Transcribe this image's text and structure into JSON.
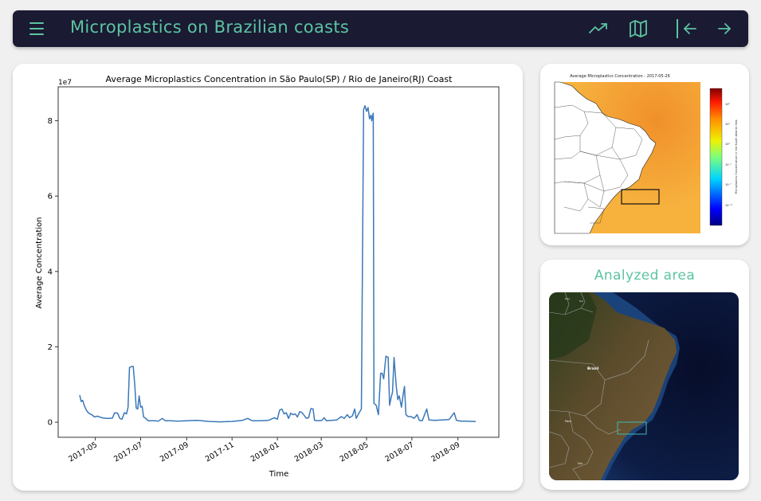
{
  "header": {
    "title": "Microplastics on Brazilian coasts",
    "icons": [
      "menu-icon",
      "trending-up-icon",
      "map-icon",
      "arrow-left-icon",
      "arrow-right-icon"
    ]
  },
  "colors": {
    "navbar_bg": "#1a1a33",
    "accent": "#5cc4a0",
    "line": "#3b78b8",
    "page_bg": "#f0f0f0"
  },
  "chart_data": {
    "type": "line",
    "title": "Average Microplastics Concentration in São Paulo(SP) / Rio de Janeiro(RJ) Coast",
    "xlabel": "Time",
    "ylabel": "Average Concentration",
    "y_scale_label": "1e7",
    "y_multiplier": 10000000,
    "ylim": [
      -0.4,
      8.9
    ],
    "xlim": [
      "2017-03-12",
      "2018-10-26"
    ],
    "yticks": [
      0,
      2,
      4,
      6,
      8
    ],
    "xticks": [
      "2017-05",
      "2017-07",
      "2017-09",
      "2017-11",
      "2018-01",
      "2018-03",
      "2018-05",
      "2018-07",
      "2018-09"
    ],
    "grid": false,
    "legend": "none",
    "series": [
      {
        "name": "Average Concentration",
        "points": [
          [
            "2017-04-10",
            0.72
          ],
          [
            "2017-04-12",
            0.55
          ],
          [
            "2017-04-14",
            0.58
          ],
          [
            "2017-04-16",
            0.45
          ],
          [
            "2017-04-19",
            0.32
          ],
          [
            "2017-04-22",
            0.24
          ],
          [
            "2017-04-26",
            0.2
          ],
          [
            "2017-04-30",
            0.14
          ],
          [
            "2017-05-04",
            0.16
          ],
          [
            "2017-05-08",
            0.13
          ],
          [
            "2017-05-12",
            0.11
          ],
          [
            "2017-05-16",
            0.1
          ],
          [
            "2017-05-20",
            0.1
          ],
          [
            "2017-05-24",
            0.11
          ],
          [
            "2017-05-27",
            0.25
          ],
          [
            "2017-05-31",
            0.24
          ],
          [
            "2017-06-03",
            0.1
          ],
          [
            "2017-06-06",
            0.08
          ],
          [
            "2017-06-09",
            0.25
          ],
          [
            "2017-06-12",
            0.22
          ],
          [
            "2017-06-14",
            0.4
          ],
          [
            "2017-06-16",
            1.45
          ],
          [
            "2017-06-19",
            1.48
          ],
          [
            "2017-06-21",
            1.48
          ],
          [
            "2017-06-23",
            1.0
          ],
          [
            "2017-06-25",
            0.38
          ],
          [
            "2017-06-27",
            0.35
          ],
          [
            "2017-06-29",
            0.7
          ],
          [
            "2017-07-01",
            0.4
          ],
          [
            "2017-07-03",
            0.42
          ],
          [
            "2017-07-05",
            0.14
          ],
          [
            "2017-07-08",
            0.1
          ],
          [
            "2017-07-11",
            0.04
          ],
          [
            "2017-07-15",
            0.04
          ],
          [
            "2017-07-20",
            0.04
          ],
          [
            "2017-07-25",
            0.03
          ],
          [
            "2017-07-30",
            0.1
          ],
          [
            "2017-08-03",
            0.04
          ],
          [
            "2017-08-10",
            0.04
          ],
          [
            "2017-08-20",
            0.03
          ],
          [
            "2017-09-01",
            0.04
          ],
          [
            "2017-09-15",
            0.05
          ],
          [
            "2017-10-01",
            0.02
          ],
          [
            "2017-10-15",
            0.01
          ],
          [
            "2017-11-01",
            0.02
          ],
          [
            "2017-11-15",
            0.05
          ],
          [
            "2017-11-22",
            0.1
          ],
          [
            "2017-11-28",
            0.04
          ],
          [
            "2017-12-10",
            0.04
          ],
          [
            "2017-12-20",
            0.05
          ],
          [
            "2017-12-28",
            0.12
          ],
          [
            "2018-01-01",
            0.08
          ],
          [
            "2018-01-04",
            0.32
          ],
          [
            "2018-01-07",
            0.35
          ],
          [
            "2018-01-10",
            0.22
          ],
          [
            "2018-01-13",
            0.25
          ],
          [
            "2018-01-16",
            0.1
          ],
          [
            "2018-01-19",
            0.24
          ],
          [
            "2018-01-22",
            0.2
          ],
          [
            "2018-01-25",
            0.22
          ],
          [
            "2018-01-28",
            0.14
          ],
          [
            "2018-01-31",
            0.28
          ],
          [
            "2018-02-03",
            0.26
          ],
          [
            "2018-02-06",
            0.18
          ],
          [
            "2018-02-09",
            0.1
          ],
          [
            "2018-02-12",
            0.12
          ],
          [
            "2018-02-15",
            0.36
          ],
          [
            "2018-02-18",
            0.35
          ],
          [
            "2018-02-20",
            0.05
          ],
          [
            "2018-02-25",
            0.04
          ],
          [
            "2018-03-02",
            0.05
          ],
          [
            "2018-03-05",
            0.12
          ],
          [
            "2018-03-08",
            0.04
          ],
          [
            "2018-03-15",
            0.05
          ],
          [
            "2018-03-22",
            0.06
          ],
          [
            "2018-03-28",
            0.15
          ],
          [
            "2018-04-01",
            0.1
          ],
          [
            "2018-04-05",
            0.2
          ],
          [
            "2018-04-08",
            0.12
          ],
          [
            "2018-04-12",
            0.17
          ],
          [
            "2018-04-15",
            0.35
          ],
          [
            "2018-04-17",
            0.1
          ],
          [
            "2018-04-21",
            0.25
          ],
          [
            "2018-04-24",
            0.35
          ],
          [
            "2018-04-27",
            8.3
          ],
          [
            "2018-04-29",
            8.4
          ],
          [
            "2018-05-01",
            8.25
          ],
          [
            "2018-05-03",
            8.35
          ],
          [
            "2018-05-05",
            8.05
          ],
          [
            "2018-05-07",
            8.15
          ],
          [
            "2018-05-08",
            8.0
          ],
          [
            "2018-05-10",
            8.2
          ],
          [
            "2018-05-11",
            0.5
          ],
          [
            "2018-05-14",
            0.45
          ],
          [
            "2018-05-17",
            0.2
          ],
          [
            "2018-05-20",
            1.3
          ],
          [
            "2018-05-22",
            1.3
          ],
          [
            "2018-05-24",
            1.15
          ],
          [
            "2018-05-27",
            1.75
          ],
          [
            "2018-05-30",
            1.72
          ],
          [
            "2018-06-01",
            0.45
          ],
          [
            "2018-06-03",
            0.65
          ],
          [
            "2018-06-05",
            0.8
          ],
          [
            "2018-06-07",
            1.72
          ],
          [
            "2018-06-10",
            0.95
          ],
          [
            "2018-06-12",
            0.6
          ],
          [
            "2018-06-14",
            0.7
          ],
          [
            "2018-06-17",
            0.4
          ],
          [
            "2018-06-19",
            0.7
          ],
          [
            "2018-06-21",
            0.95
          ],
          [
            "2018-06-23",
            0.2
          ],
          [
            "2018-06-26",
            0.15
          ],
          [
            "2018-06-30",
            0.15
          ],
          [
            "2018-07-04",
            0.1
          ],
          [
            "2018-07-08",
            0.2
          ],
          [
            "2018-07-11",
            0.05
          ],
          [
            "2018-07-15",
            0.04
          ],
          [
            "2018-07-21",
            0.35
          ],
          [
            "2018-07-24",
            0.06
          ],
          [
            "2018-08-01",
            0.05
          ],
          [
            "2018-08-10",
            0.06
          ],
          [
            "2018-08-20",
            0.07
          ],
          [
            "2018-08-27",
            0.25
          ],
          [
            "2018-08-30",
            0.05
          ],
          [
            "2018-09-05",
            0.03
          ],
          [
            "2018-09-12",
            0.03
          ],
          [
            "2018-09-20",
            0.02
          ],
          [
            "2018-09-25",
            0.02
          ]
        ]
      }
    ]
  },
  "heatmap_card": {
    "title": "Average Microplastics Concentration - 2017-05-26",
    "colorbar_label": "Microplastics Concentration  in the South Atlantic Sea",
    "colorbar_ticks": [
      "10⁰",
      "10¹",
      "10²",
      "10⁻¹",
      "10⁻⁷",
      "10⁻¹¹"
    ]
  },
  "area_card": {
    "title": "Analyzed area",
    "map_labels": [
      "Brazil",
      "Para",
      "Uru",
      "Guy",
      "Sur"
    ]
  }
}
